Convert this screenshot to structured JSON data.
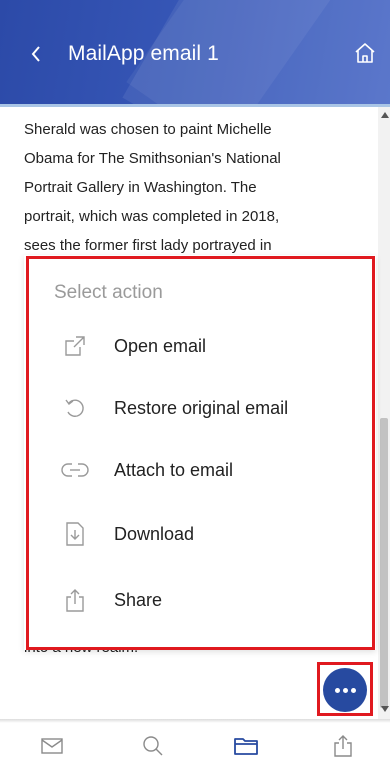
{
  "header": {
    "title": "MailApp email 1",
    "back_icon": "chevron-left-icon",
    "home_icon": "home-icon",
    "background": "#3656b6"
  },
  "email": {
    "body_lines": [
      "Sherald was chosen to paint Michelle",
      "Obama for The Smithsonian's National",
      "Portrait Gallery in Washington. The",
      "portrait, which was completed in 2018,",
      "sees the former first lady portrayed in"
    ],
    "tail_text": "into a new realm."
  },
  "action_sheet": {
    "title": "Select action",
    "actions": [
      {
        "label": "Open email",
        "icon": "open-external-icon"
      },
      {
        "label": "Restore original email",
        "icon": "restore-icon"
      },
      {
        "label": "Attach to email",
        "icon": "attach-link-icon"
      },
      {
        "label": "Download",
        "icon": "download-icon"
      },
      {
        "label": "Share",
        "icon": "share-icon"
      }
    ],
    "highlight_color": "#e0191f"
  },
  "fab": {
    "icon": "more-icon",
    "color": "#274aa0"
  },
  "tabbar": {
    "items": [
      {
        "icon": "mail-icon"
      },
      {
        "icon": "search-icon"
      },
      {
        "icon": "folder-icon",
        "active": true
      },
      {
        "icon": "share-icon"
      }
    ],
    "active_color": "#274aa0",
    "inactive_color": "#8a8a8a"
  }
}
